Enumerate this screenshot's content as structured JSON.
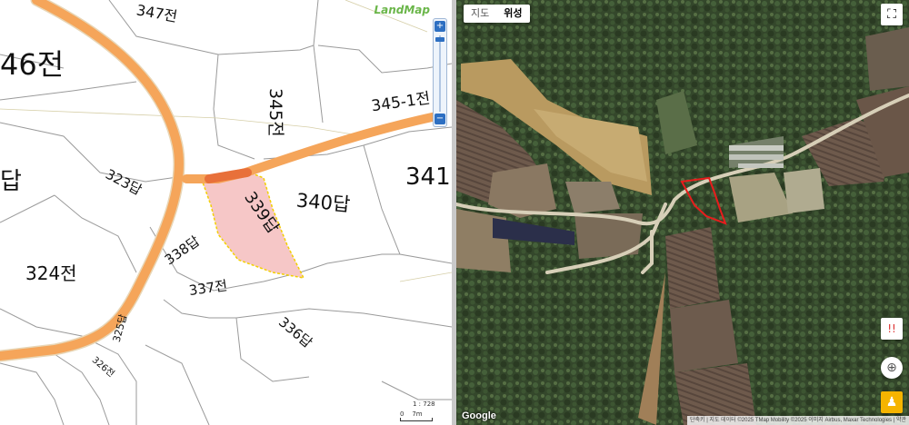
{
  "cadastral_map": {
    "logo": "LandMap",
    "scale_text": "1 : 728",
    "scale_bar_label": "0    7m",
    "parcels": [
      {
        "label": "347전"
      },
      {
        "label": "46전"
      },
      {
        "label": "345전"
      },
      {
        "label": "345-1전"
      },
      {
        "label": "341"
      },
      {
        "label": "답"
      },
      {
        "label": "323답"
      },
      {
        "label": "339답"
      },
      {
        "label": "340답"
      },
      {
        "label": "338답"
      },
      {
        "label": "324전"
      },
      {
        "label": "337전"
      },
      {
        "label": "336답"
      },
      {
        "label": "325답"
      },
      {
        "label": "326전"
      }
    ],
    "highlight_color": "#f6c7c7",
    "road_color": "#f5a55a"
  },
  "satellite_map": {
    "map_type_tabs": [
      "지도",
      "위성"
    ],
    "active_tab": "위성",
    "logo": "Google",
    "attribution": "단축키 | 지도 데이터 ©2025 TMap Mobility ©2025 이미지 Airbus, Maxar Technologies | 약관",
    "marker_color": "#e81c1c"
  }
}
